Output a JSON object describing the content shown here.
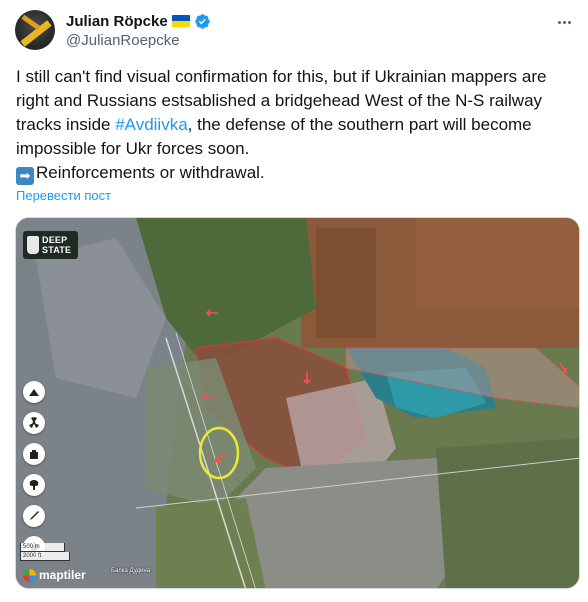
{
  "author": {
    "display_name": "Julian Röpcke",
    "handle": "@JulianRoepcke",
    "verified": true,
    "flag": "ukraine-flag"
  },
  "tweet": {
    "line1": "I still can't find visual confirmation for this, but if Ukrainian mappers are right and Russians estsablished a bridgehead West of the N-S railway tracks inside ",
    "hashtag": "#Avdiivka",
    "line1_end": ", the defense of the southern part will become impossible for Ukr forces soon.",
    "line2": "Reinforcements or withdrawal."
  },
  "translate_label": "Перевести пост",
  "map": {
    "logo_line1": "DEEP",
    "logo_line2": "STATE",
    "scale_top": "500 m",
    "scale_bottom": "2000 ft",
    "attribution": "maptiler",
    "place_label": "Балка Дудина",
    "tools": [
      "landmark-icon",
      "radiation-icon",
      "fortress-icon",
      "explosion-icon",
      "missile-icon",
      "fire-icon"
    ]
  },
  "colors": {
    "accent": "#1d9bf0",
    "text": "#0f1419",
    "secondary": "#536471",
    "occupied_red": "#c0392b"
  }
}
